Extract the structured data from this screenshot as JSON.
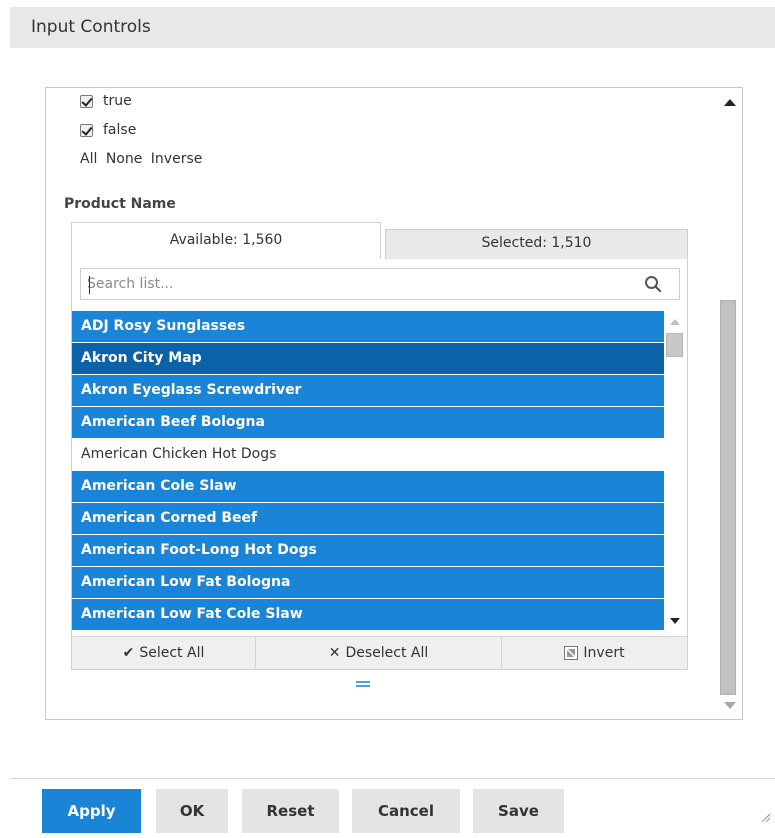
{
  "header": {
    "title": "Input Controls"
  },
  "boolean_filter": {
    "options": [
      {
        "label": "true",
        "checked": true
      },
      {
        "label": "false",
        "checked": true
      }
    ],
    "links": [
      "All",
      "None",
      "Inverse"
    ]
  },
  "product_filter": {
    "label": "Product Name",
    "tabs": {
      "available": "Available: 1,560",
      "selected": "Selected: 1,510"
    },
    "search": {
      "placeholder": "Search list...",
      "value": ""
    },
    "items": [
      {
        "label": "ADJ Rosy Sunglasses",
        "state": "selected"
      },
      {
        "label": "Akron City Map",
        "state": "focused"
      },
      {
        "label": "Akron Eyeglass Screwdriver",
        "state": "selected"
      },
      {
        "label": "American Beef Bologna",
        "state": "selected"
      },
      {
        "label": "American Chicken Hot Dogs",
        "state": "unselected"
      },
      {
        "label": "American Cole Slaw",
        "state": "selected"
      },
      {
        "label": "American Corned Beef",
        "state": "selected"
      },
      {
        "label": "American Foot-Long Hot Dogs",
        "state": "selected"
      },
      {
        "label": "American Low Fat Bologna",
        "state": "selected"
      },
      {
        "label": "American Low Fat Cole Slaw",
        "state": "selected"
      }
    ],
    "toolbar": {
      "select_all": "Select All",
      "deselect_all": "Deselect All",
      "invert": "Invert"
    }
  },
  "footer": {
    "apply": "Apply",
    "ok": "OK",
    "reset": "Reset",
    "cancel": "Cancel",
    "save": "Save"
  },
  "colors": {
    "accent": "#1a84d6",
    "focused_row": "#0c62a8",
    "header_bg": "#e8e8e8",
    "button_bg": "#e4e4e4"
  }
}
